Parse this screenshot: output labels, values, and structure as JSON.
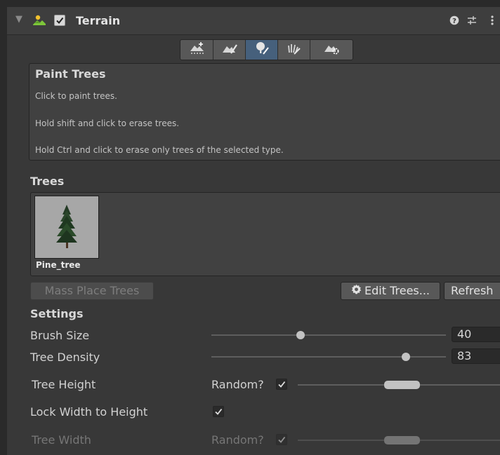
{
  "component": {
    "title": "Terrain",
    "enabled": true,
    "icons": [
      "terrain-icon",
      "help-icon",
      "preset-icon",
      "more-icon"
    ]
  },
  "toolbar": {
    "tools": [
      "raise-terrain-icon",
      "paint-terrain-icon",
      "paint-trees-icon",
      "paint-details-icon",
      "terrain-settings-icon"
    ],
    "active_index": 2
  },
  "help": {
    "title": "Paint Trees",
    "lines": [
      "Click to paint trees.",
      "Hold shift and click to erase trees.",
      "Hold Ctrl and click to erase only trees of the selected type."
    ]
  },
  "trees": {
    "heading": "Trees",
    "items": [
      {
        "label": "Pine_tree"
      }
    ]
  },
  "buttons": {
    "mass_place": "Mass Place Trees",
    "edit_trees": "Edit Trees...",
    "refresh": "Refresh"
  },
  "settings": {
    "heading": "Settings",
    "brush_size": {
      "label": "Brush Size",
      "value": "40",
      "fraction": 0.38
    },
    "tree_density": {
      "label": "Tree Density",
      "value": "83",
      "fraction": 0.83
    },
    "tree_height": {
      "label": "Tree Height",
      "random_label": "Random?",
      "random": true
    },
    "lock_width": {
      "label": "Lock Width to Height",
      "checked": true
    },
    "tree_width": {
      "label": "Tree Width",
      "random_label": "Random?",
      "random": true
    }
  },
  "colors": {
    "background": "#383838",
    "active_tool": "#46607c"
  }
}
